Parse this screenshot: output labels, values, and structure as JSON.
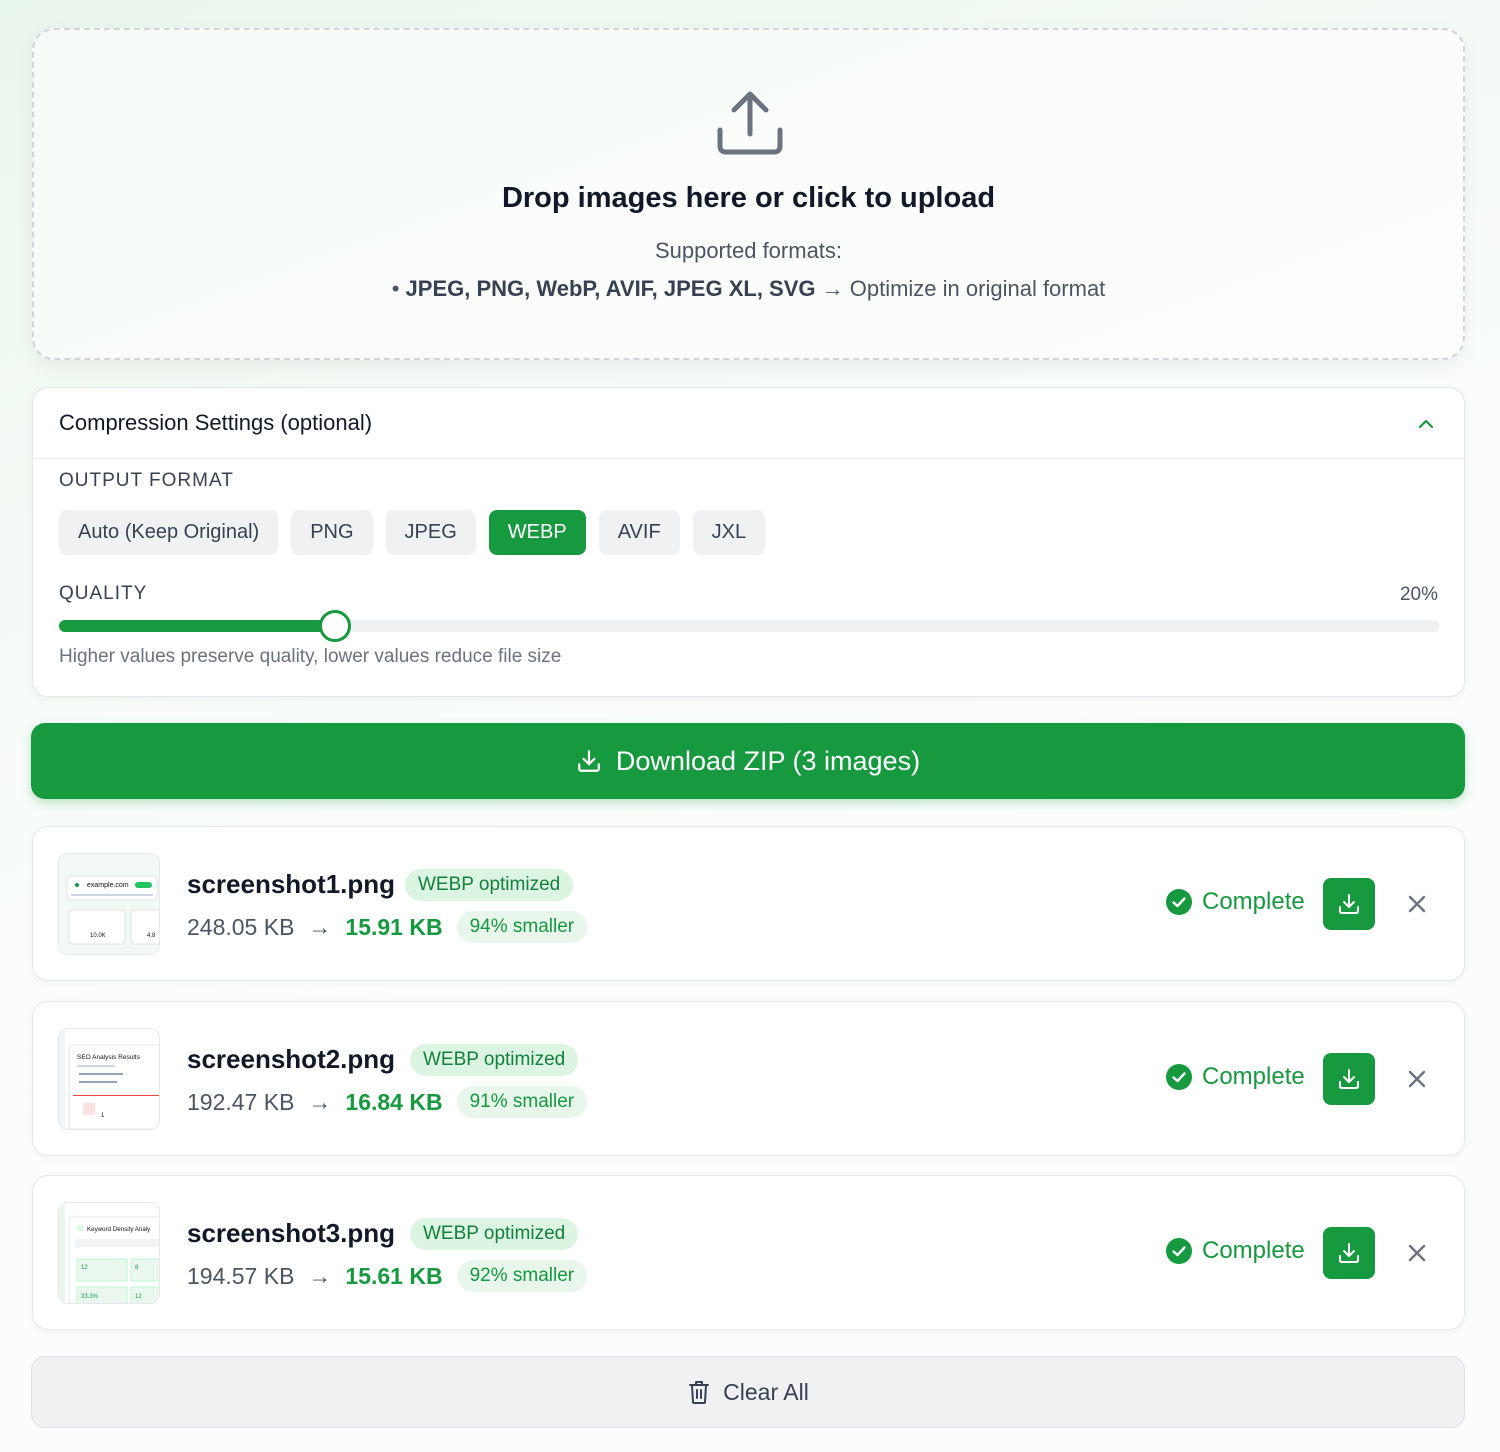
{
  "upload": {
    "title": "Drop images here or click to upload",
    "supported_label": "Supported formats:",
    "formats_bullet": "• ",
    "formats_list": "JPEG, PNG, WebP, AVIF, JPEG XL, SVG",
    "formats_arrow": " → ",
    "formats_note": "Optimize in original format",
    "icon": "upload-icon"
  },
  "settings": {
    "title": "Compression Settings (optional)",
    "output_format_label": "OUTPUT FORMAT",
    "formats": [
      "Auto (Keep Original)",
      "PNG",
      "JPEG",
      "WEBP",
      "AVIF",
      "JXL"
    ],
    "selected_format": "WEBP",
    "quality_label": "QUALITY",
    "quality_value_text": "20%",
    "quality_value": 0.2,
    "quality_help": "Higher values preserve quality, lower values reduce file size"
  },
  "zip_button": {
    "label": "Download ZIP (3 images)",
    "icon": "download-icon"
  },
  "files": [
    {
      "name": "screenshot1.png",
      "badge": "WEBP optimized",
      "original_size": "248.05 KB",
      "arrow": "→",
      "new_size": "15.91 KB",
      "savings": "94% smaller",
      "status": "Complete",
      "thumb_text": [
        "example.com",
        "10.0K",
        "4.8"
      ]
    },
    {
      "name": "screenshot2.png",
      "badge": "WEBP optimized",
      "original_size": "192.47 KB",
      "arrow": "→",
      "new_size": "16.84 KB",
      "savings": "91% smaller",
      "status": "Complete",
      "thumb_text": [
        "SEO Analysis Results",
        "1"
      ]
    },
    {
      "name": "screenshot3.png",
      "badge": "WEBP optimized",
      "original_size": "194.57 KB",
      "arrow": "→",
      "new_size": "15.61 KB",
      "savings": "92% smaller",
      "status": "Complete",
      "thumb_text": [
        "Keyword Density Analy",
        "12",
        "8",
        "33.3%",
        "12"
      ]
    }
  ],
  "clear_button": {
    "label": "Clear All",
    "icon": "trash-icon"
  },
  "colors": {
    "accent": "#16993f",
    "accent_light": "#dcf5e3",
    "muted_bg": "#f0f1f3"
  }
}
